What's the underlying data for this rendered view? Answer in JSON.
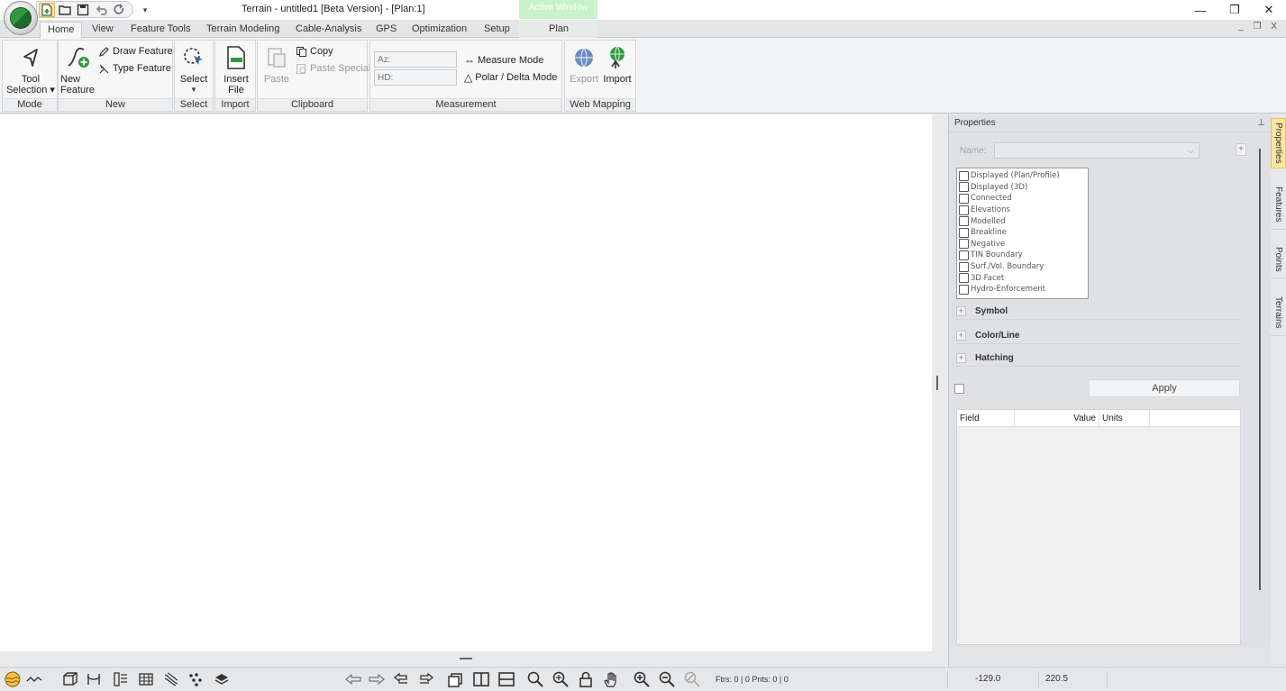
{
  "window": {
    "title": "Terrain - untitled1 [Beta Version] - [Plan:1]",
    "context_label": "Active Window",
    "minimize_glyph": "—",
    "maximize_glyph": "❐",
    "close_glyph": "✕",
    "mdi_controls": "_ ❐ X"
  },
  "quick_access": {
    "icons": [
      "new-file-icon",
      "open-folder-icon",
      "save-icon",
      "undo-icon",
      "redo-icon"
    ],
    "more_glyph": "▾"
  },
  "tabs": [
    {
      "label": "Home",
      "selected": true
    },
    {
      "label": "View"
    },
    {
      "label": "Feature Tools"
    },
    {
      "label": "Terrain Modeling"
    },
    {
      "label": "Cable-Analysis"
    },
    {
      "label": "GPS"
    },
    {
      "label": "Optimization"
    },
    {
      "label": "Setup"
    },
    {
      "label": "Plan"
    }
  ],
  "ribbon": {
    "mode": {
      "group": "Mode",
      "tool_line1": "Tool",
      "tool_line2": "Selection ▾"
    },
    "new": {
      "group": "New",
      "new_line1": "New",
      "new_line2": "Feature",
      "draw_feature": "Draw Feature",
      "type_feature": "Type Feature"
    },
    "select": {
      "group": "Select",
      "select": "Select"
    },
    "import": {
      "group": "Import",
      "insert_line1": "Insert",
      "insert_line2": "File"
    },
    "clipboard": {
      "group": "Clipboard",
      "paste": "Paste",
      "copy": "Copy",
      "paste_special": "Paste Special"
    },
    "measurement": {
      "group": "Measurement",
      "az_placeholder": "Az:",
      "hd_placeholder": "HD:",
      "measure_mode": "Measure Mode",
      "polar_delta_mode": "Polar / Delta Mode"
    },
    "web_mapping": {
      "group": "Web Mapping",
      "export": "Export",
      "import": "Import"
    }
  },
  "properties": {
    "title": "Properties",
    "pin_glyph": "⊥",
    "name_label": "Name:",
    "name_value": "",
    "add_glyph": "+",
    "flags": [
      "Displayed (Plan/Profile)",
      "Displayed (3D)",
      "Connected",
      "Elevations",
      "Modelled",
      "Breakline",
      "Negative",
      "TIN Boundary",
      "Surf./Vol. Boundary",
      "3D Facet",
      "Hydro-Enforcement"
    ],
    "sections": [
      "Symbol",
      "Color/Line",
      "Hatching"
    ],
    "apply": "Apply",
    "grid_columns": [
      "Field",
      "Value",
      "Units"
    ]
  },
  "side_tabs": [
    {
      "label": "Properties",
      "selected": true
    },
    {
      "label": "Features"
    },
    {
      "label": "Points"
    },
    {
      "label": "Terrains"
    }
  ],
  "status": {
    "counts": "Ftrs: 0 | 0  Pnts: 0 | 0",
    "x": "-129.0",
    "y": "220.5"
  },
  "colors": {
    "accent_yellow": "#fbe6a2",
    "brand_green": "#2f9a3d",
    "toolbar_icon_blue": "#3a5ea8"
  }
}
